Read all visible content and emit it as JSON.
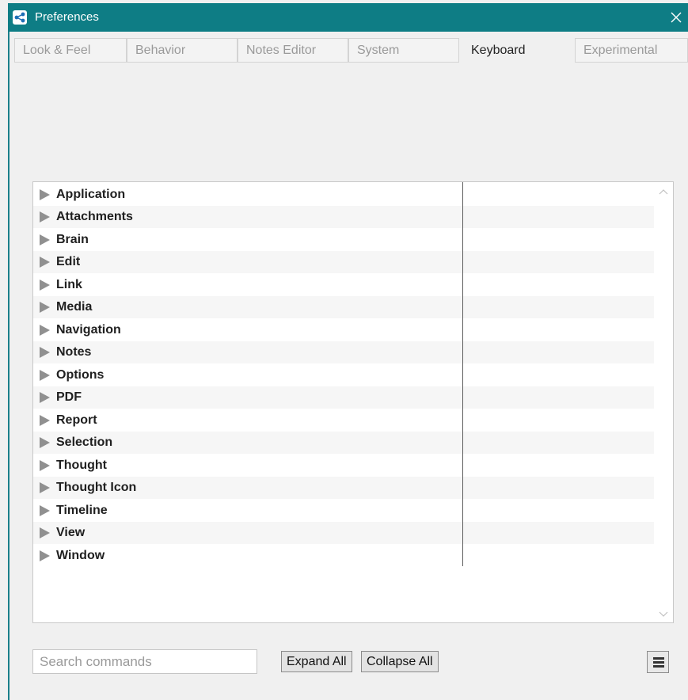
{
  "window": {
    "title": "Preferences"
  },
  "tabs": [
    {
      "label": "Look & Feel"
    },
    {
      "label": "Behavior"
    },
    {
      "label": "Notes Editor"
    },
    {
      "label": "System"
    },
    {
      "label": "Keyboard",
      "active": true
    },
    {
      "label": "Experimental"
    }
  ],
  "commands": [
    {
      "label": "Application"
    },
    {
      "label": "Attachments"
    },
    {
      "label": "Brain"
    },
    {
      "label": "Edit"
    },
    {
      "label": "Link"
    },
    {
      "label": "Media"
    },
    {
      "label": "Navigation"
    },
    {
      "label": "Notes"
    },
    {
      "label": "Options"
    },
    {
      "label": "PDF"
    },
    {
      "label": "Report"
    },
    {
      "label": "Selection"
    },
    {
      "label": "Thought"
    },
    {
      "label": "Thought Icon"
    },
    {
      "label": "Timeline"
    },
    {
      "label": "View"
    },
    {
      "label": "Window"
    }
  ],
  "search": {
    "placeholder": "Search commands",
    "value": ""
  },
  "buttons": {
    "expand_all": "Expand All",
    "collapse_all": "Collapse All"
  },
  "icons": {
    "app": "thebrain-app-icon",
    "close": "close-icon",
    "menu": "hamburger-menu-icon",
    "expander": "triangle-right-icon"
  },
  "colors": {
    "titlebar": "#0e7d85",
    "accent_border": "#1a7f8a"
  }
}
